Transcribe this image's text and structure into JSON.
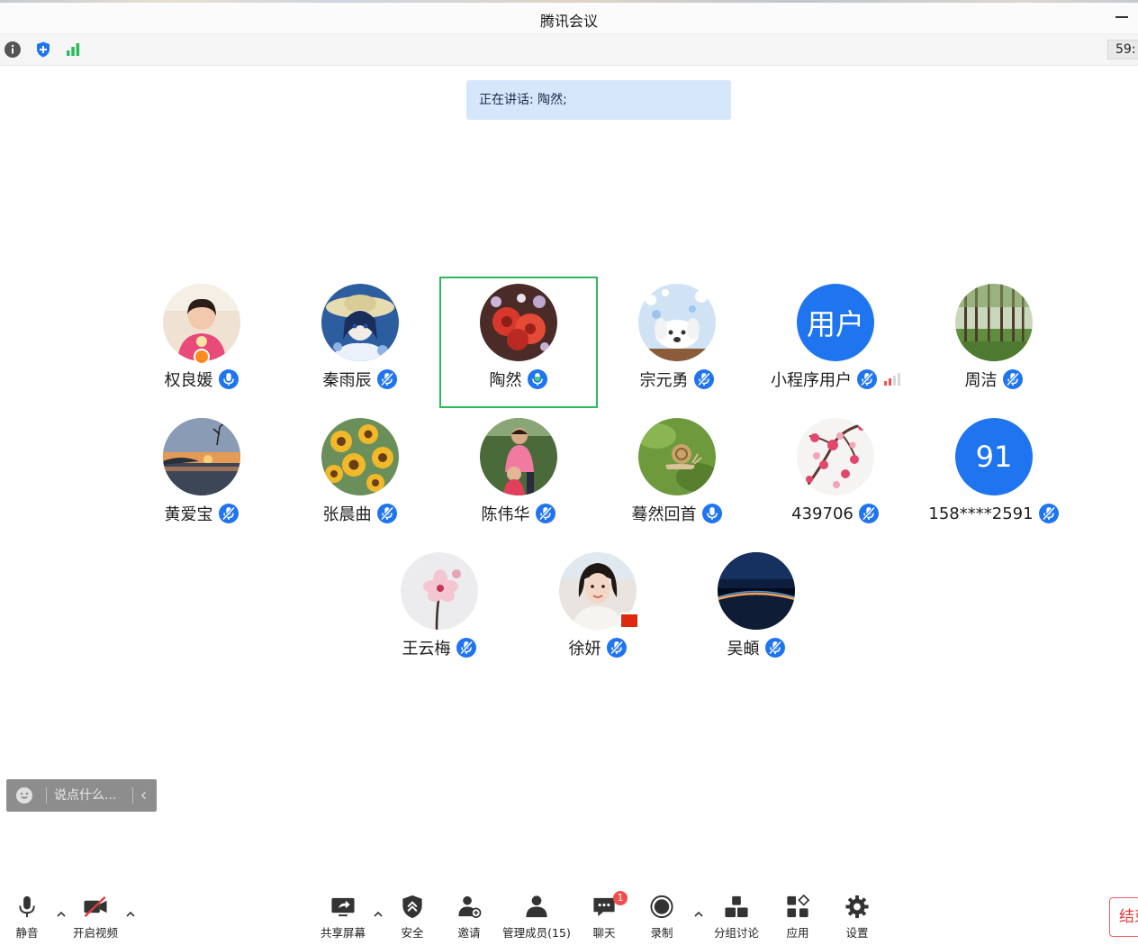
{
  "window": {
    "title": "腾讯会议"
  },
  "infobar": {
    "timer": "59:"
  },
  "speaker": {
    "banner": "正在讲话: 陶然;"
  },
  "participants": [
    {
      "name": "权良媛",
      "avatar": "photo-girl",
      "mic": "on",
      "host": true
    },
    {
      "name": "秦雨辰",
      "avatar": "anime-girl",
      "mic": "muted"
    },
    {
      "name": "陶然",
      "avatar": "red-flowers",
      "mic": "speaking",
      "active": true
    },
    {
      "name": "宗元勇",
      "avatar": "cartoon-dog",
      "mic": "muted"
    },
    {
      "name": "小程序用户",
      "avatar_text": "用户",
      "mic": "muted",
      "signal": "weak"
    },
    {
      "name": "周洁",
      "avatar": "forest",
      "mic": "muted"
    },
    {
      "name": "黄爱宝",
      "avatar": "sunset-lake",
      "mic": "muted"
    },
    {
      "name": "张晨曲",
      "avatar": "sunflowers",
      "mic": "muted"
    },
    {
      "name": "陈伟华",
      "avatar": "woman-child",
      "mic": "muted"
    },
    {
      "name": "蓦然回首",
      "avatar": "snail",
      "mic": "on"
    },
    {
      "name": "439706",
      "avatar": "plum-blossom",
      "mic": "muted"
    },
    {
      "name": "158****2591",
      "avatar_text": "91",
      "mic": "muted"
    },
    {
      "name": "王云梅",
      "avatar": "pink-flower",
      "mic": "muted"
    },
    {
      "name": "徐妍",
      "avatar": "woman-portrait",
      "mic": "muted",
      "flag": true
    },
    {
      "name": "吴頔",
      "avatar": "earth-horizon",
      "mic": "muted"
    }
  ],
  "chat": {
    "placeholder": "说点什么..."
  },
  "toolbar": {
    "mute": "静音",
    "video": "开启视频",
    "share": "共享屏幕",
    "security": "安全",
    "invite": "邀请",
    "members": "管理成员(15)",
    "chat": "聊天",
    "chat_badge": "1",
    "record": "录制",
    "breakout": "分组讨论",
    "apps": "应用",
    "settings": "设置",
    "end": "结束"
  },
  "colors": {
    "accent": "#1f74f0",
    "active_border": "#2dba5d",
    "banner_bg": "#d6e7fb",
    "end_red": "#e53b3b"
  }
}
